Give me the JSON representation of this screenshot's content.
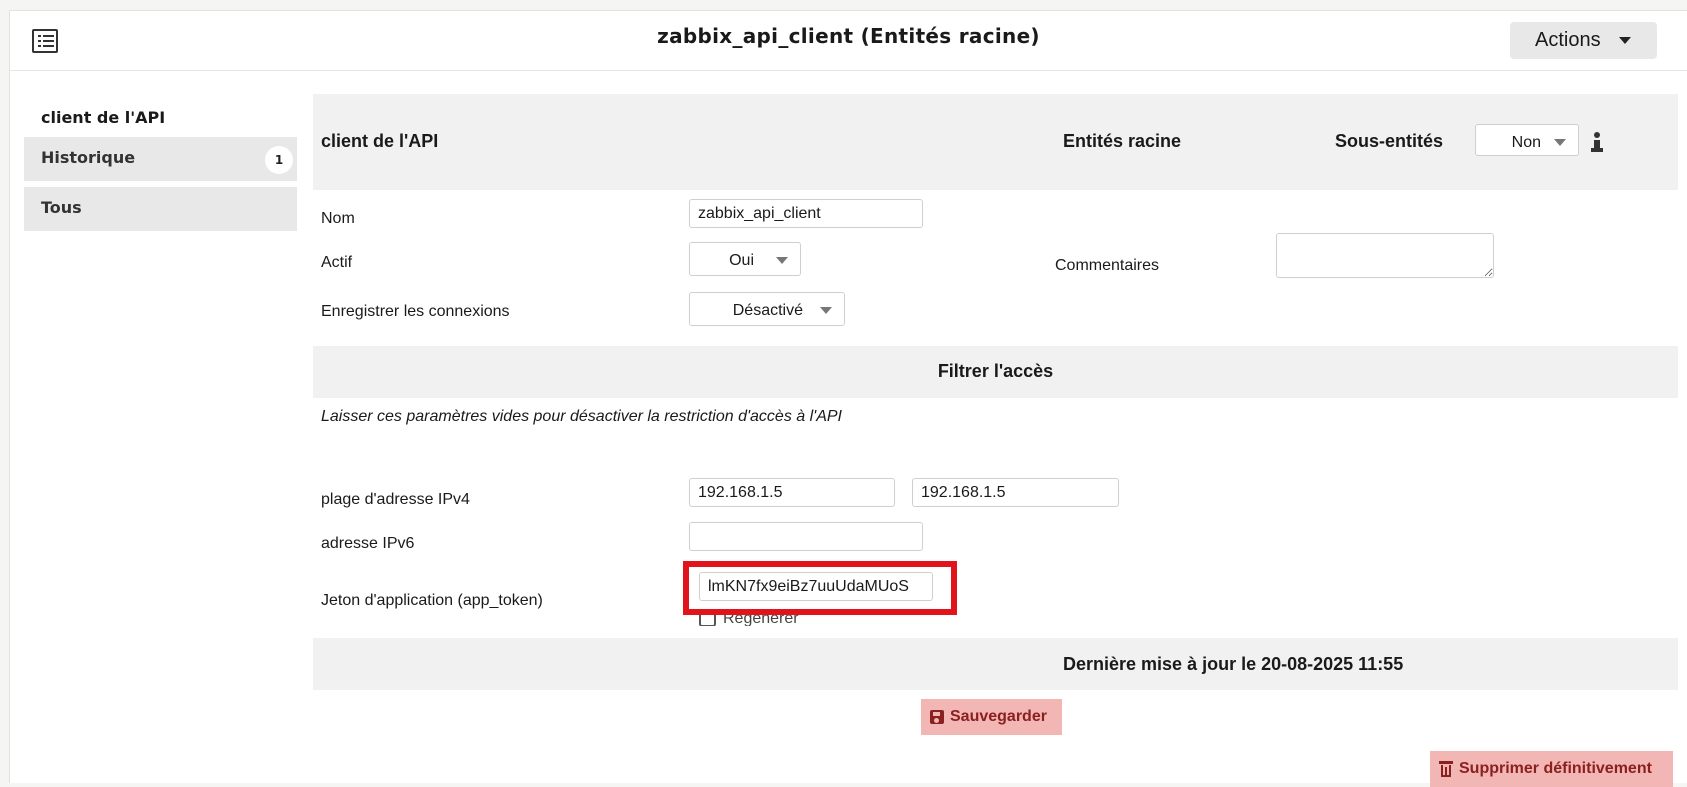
{
  "header": {
    "title": "zabbix_api_client (Entités racine)",
    "actions_label": "Actions"
  },
  "sidebar": {
    "heading": "client de l'API",
    "items": [
      {
        "label": "Historique",
        "badge": "1"
      },
      {
        "label": "Tous"
      }
    ]
  },
  "form": {
    "header": {
      "label": "client de l'API",
      "entity": "Entités racine",
      "subentities_label": "Sous-entités",
      "subentities_value": "Non"
    },
    "fields": {
      "name_label": "Nom",
      "name_value": "zabbix_api_client",
      "active_label": "Actif",
      "active_value": "Oui",
      "comments_label": "Commentaires",
      "log_label": "Enregistrer les connexions",
      "log_value": "Désactivé"
    },
    "filter": {
      "title": "Filtrer l'accès",
      "hint": "Laisser ces paramètres vides pour désactiver la restriction d'accès à l'API",
      "ipv4_label": "plage d'adresse IPv4",
      "ipv4_start": "192.168.1.5",
      "ipv4_separator": "-",
      "ipv4_end": "192.168.1.5",
      "ipv6_label": "adresse IPv6",
      "ipv6_value": "",
      "token_label": "Jeton d'application (app_token)",
      "token_value": "lmKN7fx9eiBz7uuUdaMUoS",
      "regen_label": "Regénérer"
    },
    "last_update": "Dernière mise à jour le 20-08-2025 11:55",
    "save_label": "Sauvegarder",
    "delete_label": "Supprimer définitivement"
  },
  "colors": {
    "highlight": "#e0141a",
    "danger_bg": "#f2b6b4",
    "danger_text": "#8b2020"
  }
}
